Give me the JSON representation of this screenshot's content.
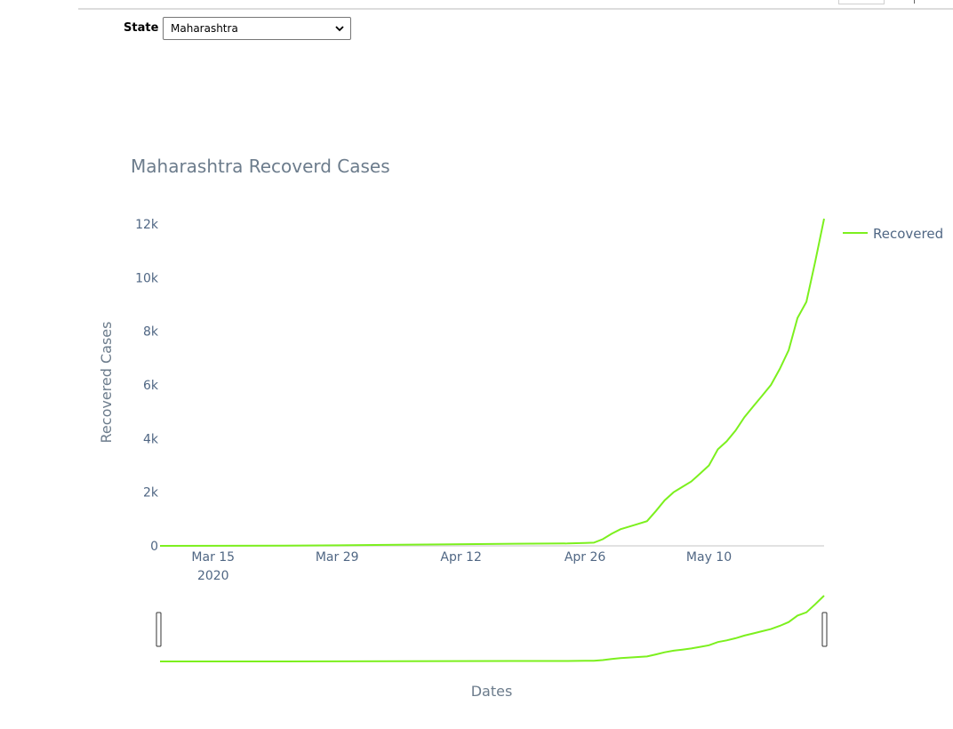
{
  "selector": {
    "label": "State",
    "selected": "Maharashtra"
  },
  "colors": {
    "series": "#7cf01e",
    "axis_text": "#506784"
  },
  "chart_data": {
    "type": "line",
    "title": "Maharashtra Recoverd Cases",
    "xlabel": "Dates",
    "ylabel": "Recovered Cases",
    "x_ticks": [
      {
        "date": "2020-03-15",
        "label": "Mar 15",
        "sublabel": "2020"
      },
      {
        "date": "2020-03-29",
        "label": "Mar 29"
      },
      {
        "date": "2020-04-12",
        "label": "Apr 12"
      },
      {
        "date": "2020-04-26",
        "label": "Apr 26"
      },
      {
        "date": "2020-05-10",
        "label": "May 10"
      }
    ],
    "y_ticks": [
      {
        "value": 0,
        "label": "0"
      },
      {
        "value": 2000,
        "label": "2k"
      },
      {
        "value": 4000,
        "label": "4k"
      },
      {
        "value": 6000,
        "label": "6k"
      },
      {
        "value": 8000,
        "label": "8k"
      },
      {
        "value": 10000,
        "label": "10k"
      },
      {
        "value": 12000,
        "label": "12k"
      }
    ],
    "xlim": [
      "2020-03-09",
      "2020-05-23"
    ],
    "ylim": [
      0,
      12200
    ],
    "legend": "top-right",
    "grid": false,
    "range_slider": true,
    "series": [
      {
        "name": "Recovered",
        "x": [
          "2020-03-09",
          "2020-03-23",
          "2020-04-05",
          "2020-04-18",
          "2020-04-24",
          "2020-04-25",
          "2020-04-26",
          "2020-04-27",
          "2020-04-28",
          "2020-04-29",
          "2020-04-30",
          "2020-05-01",
          "2020-05-02",
          "2020-05-03",
          "2020-05-04",
          "2020-05-05",
          "2020-05-06",
          "2020-05-07",
          "2020-05-08",
          "2020-05-09",
          "2020-05-10",
          "2020-05-11",
          "2020-05-12",
          "2020-05-13",
          "2020-05-14",
          "2020-05-15",
          "2020-05-16",
          "2020-05-17",
          "2020-05-18",
          "2020-05-19",
          "2020-05-20",
          "2020-05-21",
          "2020-05-22",
          "2020-05-23"
        ],
        "y": [
          0,
          5,
          40,
          80,
          90,
          100,
          110,
          120,
          250,
          450,
          620,
          720,
          820,
          920,
          1300,
          1700,
          2000,
          2200,
          2400,
          2700,
          3000,
          3600,
          3900,
          4300,
          4800,
          5200,
          5600,
          6000,
          6600,
          7300,
          8500,
          9100,
          10600,
          12200
        ]
      }
    ]
  }
}
